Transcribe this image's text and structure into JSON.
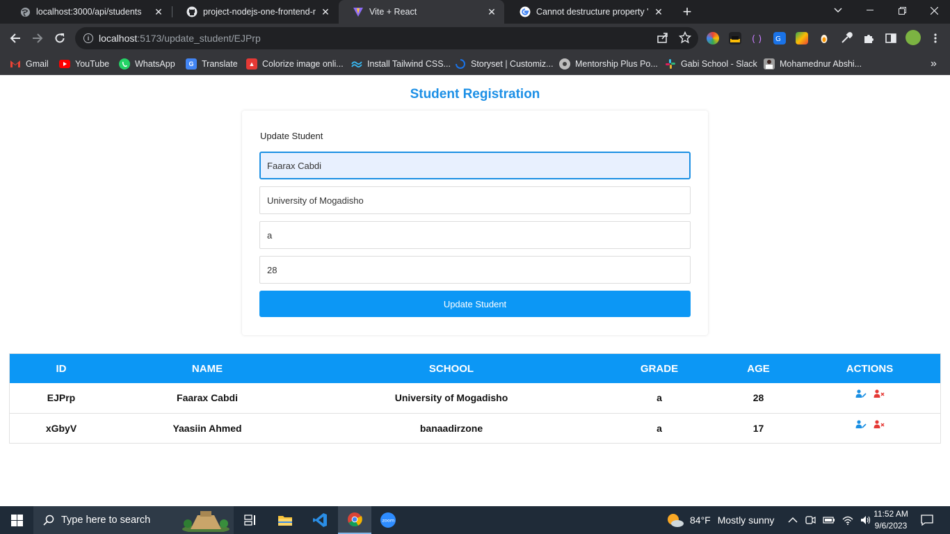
{
  "browser": {
    "tabs": [
      {
        "title": "localhost:3000/api/students",
        "close": "✕"
      },
      {
        "title": "project-nodejs-one-frontend-rea",
        "close": "✕"
      },
      {
        "title": "Vite + React",
        "close": "✕"
      },
      {
        "title": "Cannot destructure property 'bas",
        "close": "✕"
      }
    ],
    "new_tab": "+",
    "address": {
      "host": "localhost",
      "path": ":5173/update_student/EJPrp"
    },
    "bookmarks": [
      {
        "label": "Gmail",
        "icon": "gmail-icon",
        "color": "#ea4335"
      },
      {
        "label": "YouTube",
        "icon": "youtube-icon",
        "color": "#ff0000"
      },
      {
        "label": "WhatsApp",
        "icon": "whatsapp-icon",
        "color": "#25d366"
      },
      {
        "label": "Translate",
        "icon": "translate-icon",
        "color": "#4285f4"
      },
      {
        "label": "Colorize image onli...",
        "icon": "colorize-icon",
        "color": "#e53935"
      },
      {
        "label": "Install Tailwind CSS...",
        "icon": "tailwind-icon",
        "color": "#38bdf8"
      },
      {
        "label": "Storyset | Customiz...",
        "icon": "storyset-icon",
        "color": "#1a73e8"
      },
      {
        "label": "Mentorship Plus Po...",
        "icon": "mentorship-icon",
        "color": "#bdbdbd"
      },
      {
        "label": "Gabi School - Slack",
        "icon": "slack-icon",
        "color": "#e01e5a"
      },
      {
        "label": "Mohamednur Abshi...",
        "icon": "profile-icon",
        "color": "#9e9e9e"
      }
    ],
    "more_bookmarks": "»"
  },
  "page": {
    "heading": "Student Registration",
    "form": {
      "title": "Update Student",
      "name_value": "Faarax Cabdi",
      "school_value": "University of Mogadisho",
      "grade_value": "a",
      "age_value": "28",
      "submit_label": "Update Student"
    },
    "table": {
      "headers": [
        "ID",
        "NAME",
        "SCHOOL",
        "GRADE",
        "AGE",
        "ACTIONS"
      ],
      "rows": [
        {
          "id": "EJPrp",
          "name": "Faarax Cabdi",
          "school": "University of Mogadisho",
          "grade": "a",
          "age": "28"
        },
        {
          "id": "xGbyV",
          "name": "Yaasiin Ahmed",
          "school": "banaadirzone",
          "grade": "a",
          "age": "17"
        }
      ]
    },
    "colors": {
      "accent": "#0c97f5",
      "heading": "#1b8fe6",
      "edit": "#1a8fe3",
      "delete": "#e53935"
    }
  },
  "taskbar": {
    "search_placeholder": "Type here to search",
    "weather_temp": "84°F",
    "weather_text": "Mostly sunny",
    "time": "11:52 AM",
    "date": "9/6/2023"
  }
}
